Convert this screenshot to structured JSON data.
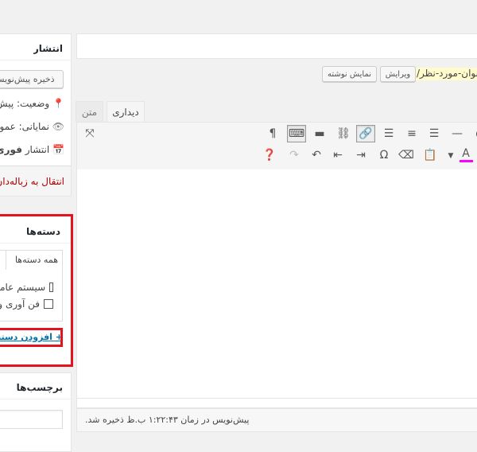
{
  "title_input": {
    "value": ""
  },
  "permalink": {
    "slug": "عنوان-مورد-نظر/",
    "edit_button": "ویرایش",
    "view_button": "نمایش نوشته"
  },
  "editor_tabs": [
    {
      "label": "دیداری",
      "active": true
    },
    {
      "label": "متن",
      "active": false
    }
  ],
  "toolbar": {
    "row1": [
      "more-icon",
      "horizontal-line-icon",
      "align-left-icon",
      "align-center-icon",
      "align-right-icon",
      "link-icon",
      "unlink-icon",
      "read-more-icon",
      "toolbar-toggle-icon",
      "paragraph-icon"
    ],
    "row2": [
      "text-color-icon",
      "dropdown-icon",
      "paste-text-icon",
      "eraser-icon",
      "special-char-icon",
      "indent-icon",
      "outdent-icon",
      "undo-icon",
      "redo-icon",
      "help-icon"
    ],
    "text_color": "#ff00ff"
  },
  "status_bar": {
    "text": "پیش‌نویس در زمان ۱:۲۲:۴۳ ب.ظ ذخیره شد."
  },
  "publish": {
    "title": "انتشار",
    "save_draft": "ذخیره پیش‌نویس",
    "status": "وضعیت: پیش‌نویس",
    "visibility": "نمایانی: عمومی",
    "schedule_prefix": "انتشار",
    "schedule_value": "فوری",
    "trash": "انتقال به زباله‌دان"
  },
  "categories": {
    "title": "دسته‌ها",
    "tab_all": "همه دسته‌ها",
    "items": [
      {
        "label": "سیستم عامل",
        "checked": false
      },
      {
        "label": "فن آوری و",
        "checked": false
      }
    ],
    "add_link": "+ افزودن دسته تازه",
    "highlight_color": "#e4131f"
  },
  "tags": {
    "title": "برچسب‌ها",
    "input_value": ""
  },
  "colors": {
    "trash": "#a00",
    "link": "#0073aa",
    "slug_bg": "#fffbcc"
  }
}
